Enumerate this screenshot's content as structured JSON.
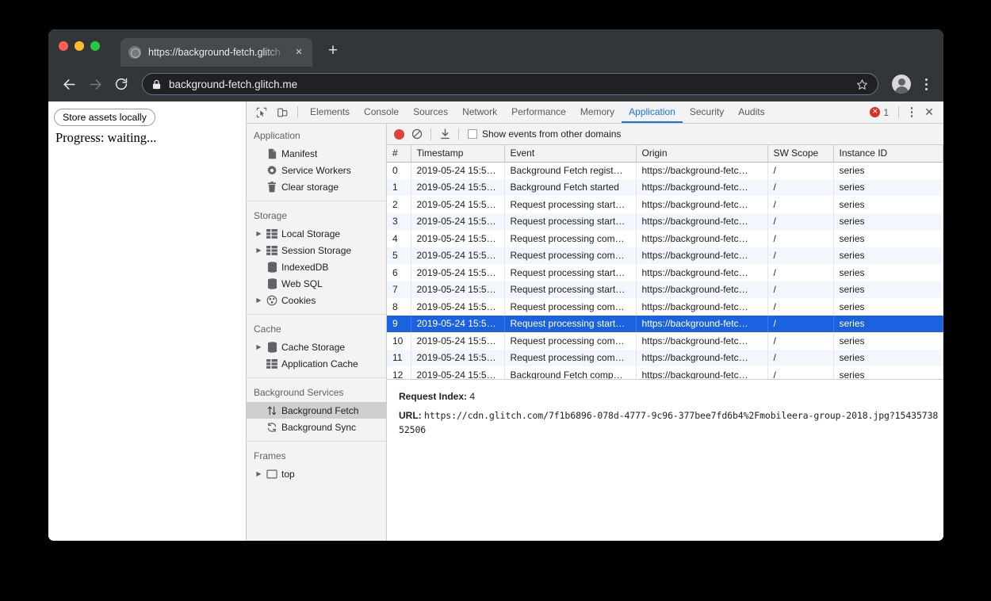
{
  "browser": {
    "tab": {
      "title": "https://background-fetch.glitch",
      "favicon": "globe-icon",
      "close": "×"
    },
    "new_tab": "+",
    "nav": {
      "back": "back-arrow-icon",
      "forward": "forward-arrow-icon",
      "reload": "reload-icon"
    },
    "omnibox": {
      "url": "background-fetch.glitch.me",
      "lock": "lock-icon",
      "star": "star-icon"
    },
    "profile": "avatar-icon",
    "menu": "kebab-menu-icon"
  },
  "page": {
    "store_assets_button": "Store assets locally",
    "progress": "Progress: waiting..."
  },
  "devtools": {
    "tabs": [
      {
        "label": "Elements",
        "active": false
      },
      {
        "label": "Console",
        "active": false
      },
      {
        "label": "Sources",
        "active": false
      },
      {
        "label": "Network",
        "active": false
      },
      {
        "label": "Performance",
        "active": false
      },
      {
        "label": "Memory",
        "active": false
      },
      {
        "label": "Application",
        "active": true
      },
      {
        "label": "Security",
        "active": false
      },
      {
        "label": "Audits",
        "active": false
      }
    ],
    "error_count": "1",
    "close_label": "✕",
    "sidebar": [
      {
        "title": "Application",
        "items": [
          {
            "label": "Manifest",
            "icon": "document-icon",
            "arrow": false,
            "selected": false
          },
          {
            "label": "Service Workers",
            "icon": "gear-icon",
            "arrow": false,
            "selected": false
          },
          {
            "label": "Clear storage",
            "icon": "trash-icon",
            "arrow": false,
            "selected": false
          }
        ]
      },
      {
        "title": "Storage",
        "items": [
          {
            "label": "Local Storage",
            "icon": "table-icon",
            "arrow": true,
            "selected": false
          },
          {
            "label": "Session Storage",
            "icon": "table-icon",
            "arrow": true,
            "selected": false
          },
          {
            "label": "IndexedDB",
            "icon": "database-icon",
            "arrow": false,
            "selected": false
          },
          {
            "label": "Web SQL",
            "icon": "database-icon",
            "arrow": false,
            "selected": false
          },
          {
            "label": "Cookies",
            "icon": "cookie-icon",
            "arrow": true,
            "selected": false
          }
        ]
      },
      {
        "title": "Cache",
        "items": [
          {
            "label": "Cache Storage",
            "icon": "database-icon",
            "arrow": true,
            "selected": false
          },
          {
            "label": "Application Cache",
            "icon": "table-icon",
            "arrow": false,
            "selected": false
          }
        ]
      },
      {
        "title": "Background Services",
        "items": [
          {
            "label": "Background Fetch",
            "icon": "up-down-arrows-icon",
            "arrow": false,
            "selected": true
          },
          {
            "label": "Background Sync",
            "icon": "refresh-icon",
            "arrow": false,
            "selected": false
          }
        ]
      },
      {
        "title": "Frames",
        "items": [
          {
            "label": "top",
            "icon": "frame-icon",
            "arrow": true,
            "selected": false
          }
        ]
      }
    ],
    "record_toolbar": {
      "record": "record-icon",
      "clear": "clear-icon",
      "download": "download-icon",
      "show_events_label": "Show events from other domains",
      "show_events_checked": false
    },
    "table": {
      "columns": [
        "#",
        "Timestamp",
        "Event",
        "Origin",
        "SW Scope",
        "Instance ID"
      ],
      "rows": [
        {
          "idx": "0",
          "ts": "2019-05-24 15:5…",
          "event": "Background Fetch regist…",
          "origin": "https://background-fetc…",
          "sw": "/",
          "iid": "series",
          "selected": false
        },
        {
          "idx": "1",
          "ts": "2019-05-24 15:5…",
          "event": "Background Fetch started",
          "origin": "https://background-fetc…",
          "sw": "/",
          "iid": "series",
          "selected": false
        },
        {
          "idx": "2",
          "ts": "2019-05-24 15:5…",
          "event": "Request processing start…",
          "origin": "https://background-fetc…",
          "sw": "/",
          "iid": "series",
          "selected": false
        },
        {
          "idx": "3",
          "ts": "2019-05-24 15:5…",
          "event": "Request processing start…",
          "origin": "https://background-fetc…",
          "sw": "/",
          "iid": "series",
          "selected": false
        },
        {
          "idx": "4",
          "ts": "2019-05-24 15:5…",
          "event": "Request processing com…",
          "origin": "https://background-fetc…",
          "sw": "/",
          "iid": "series",
          "selected": false
        },
        {
          "idx": "5",
          "ts": "2019-05-24 15:5…",
          "event": "Request processing com…",
          "origin": "https://background-fetc…",
          "sw": "/",
          "iid": "series",
          "selected": false
        },
        {
          "idx": "6",
          "ts": "2019-05-24 15:5…",
          "event": "Request processing start…",
          "origin": "https://background-fetc…",
          "sw": "/",
          "iid": "series",
          "selected": false
        },
        {
          "idx": "7",
          "ts": "2019-05-24 15:5…",
          "event": "Request processing start…",
          "origin": "https://background-fetc…",
          "sw": "/",
          "iid": "series",
          "selected": false
        },
        {
          "idx": "8",
          "ts": "2019-05-24 15:5…",
          "event": "Request processing com…",
          "origin": "https://background-fetc…",
          "sw": "/",
          "iid": "series",
          "selected": false
        },
        {
          "idx": "9",
          "ts": "2019-05-24 15:5…",
          "event": "Request processing start…",
          "origin": "https://background-fetc…",
          "sw": "/",
          "iid": "series",
          "selected": true
        },
        {
          "idx": "10",
          "ts": "2019-05-24 15:5…",
          "event": "Request processing com…",
          "origin": "https://background-fetc…",
          "sw": "/",
          "iid": "series",
          "selected": false
        },
        {
          "idx": "11",
          "ts": "2019-05-24 15:5…",
          "event": "Request processing com…",
          "origin": "https://background-fetc…",
          "sw": "/",
          "iid": "series",
          "selected": false
        },
        {
          "idx": "12",
          "ts": "2019-05-24 15:5…",
          "event": "Background Fetch comp…",
          "origin": "https://background-fetc…",
          "sw": "/",
          "iid": "series",
          "selected": false
        }
      ]
    },
    "detail": {
      "request_index_key": "Request Index:",
      "request_index_value": "4",
      "url_key": "URL:",
      "url_value": "https://cdn.glitch.com/7f1b6896-078d-4777-9c96-377bee7fd6b4%2Fmobileera-group-2018.jpg?1543573852506"
    }
  },
  "colors": {
    "accent": "#1a73e8",
    "selection": "#1a62e0",
    "record": "#db4437",
    "error": "#d93025",
    "chrome_dark": "#323639"
  }
}
